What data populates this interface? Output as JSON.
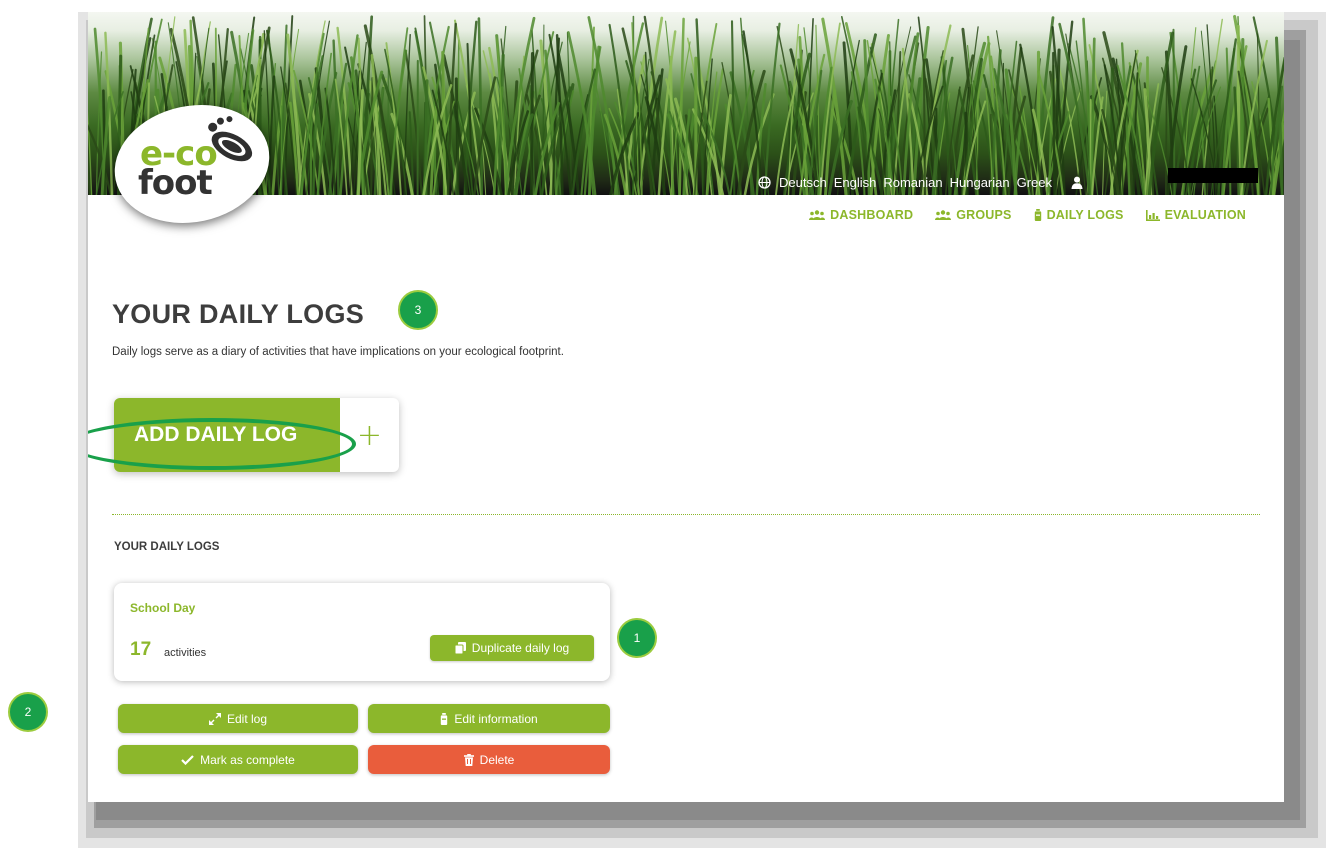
{
  "app": {
    "logo_line1": "e-co",
    "logo_line2": "foot"
  },
  "topbar": {
    "languages": [
      "Deutsch",
      "English",
      "Romanian",
      "Hungarian",
      "Greek"
    ],
    "icons": {
      "language": "globe-icon",
      "user": "user-icon"
    }
  },
  "nav": {
    "items": [
      {
        "label": "DASHBOARD",
        "icon": "users-icon"
      },
      {
        "label": "GROUPS",
        "icon": "users-icon"
      },
      {
        "label": "DAILY LOGS",
        "icon": "bottle-icon"
      },
      {
        "label": "EVALUATION",
        "icon": "chart-icon"
      }
    ]
  },
  "main": {
    "title": "YOUR DAILY LOGS",
    "subtitle": "Daily logs serve as a diary of activities that have implications on your ecological footprint.",
    "add_button_label": "ADD DAILY LOG",
    "add_button_plus": "+",
    "section_title": "YOUR DAILY LOGS"
  },
  "log_card": {
    "title": "School Day",
    "count": "17",
    "count_label": "activities",
    "duplicate_label": "Duplicate daily log"
  },
  "actions": {
    "edit_log": "Edit log",
    "edit_information": "Edit information",
    "mark_complete": "Mark as complete",
    "delete": "Delete"
  },
  "annotations": {
    "badge1": "1",
    "badge2": "2",
    "badge3": "3"
  },
  "colors": {
    "accent": "#8cb72b",
    "danger": "#e95d3c",
    "annotation": "#19a04a"
  }
}
